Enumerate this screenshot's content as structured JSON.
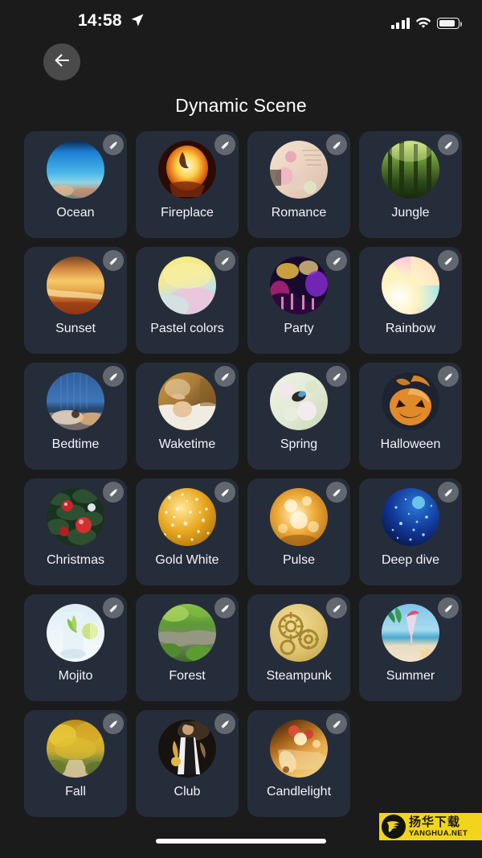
{
  "status_bar": {
    "time": "14:58",
    "location_icon": "location-arrow-icon",
    "signal_icon": "cellular-signal-icon",
    "wifi_icon": "wifi-icon",
    "battery_icon": "battery-icon",
    "battery_level": "76%"
  },
  "header": {
    "back_icon": "arrow-left-icon",
    "back_label": "Back",
    "title": "Dynamic Scene"
  },
  "colors": {
    "page_background": "#1b1b1c",
    "card_background": "#262d3a",
    "label_text": "#f2f4f7",
    "badge_background": "#7a7e85",
    "watermark_yellow": "#f2d51a",
    "home_indicator": "#ffffff"
  },
  "grid": {
    "columns": 4,
    "edit_icon": "pencil-edit-icon",
    "scenes": [
      {
        "label": "Ocean",
        "thumb": "underwater-coral-reef-photo",
        "style": "ocean"
      },
      {
        "label": "Fireplace",
        "thumb": "burning-fireplace-photo",
        "style": "fireplace"
      },
      {
        "label": "Romance",
        "thumb": "pink-roses-letter-photo",
        "style": "romance"
      },
      {
        "label": "Jungle",
        "thumb": "sunlit-jungle-trees-photo",
        "style": "jungle"
      },
      {
        "label": "Sunset",
        "thumb": "orange-beach-sunset-photo",
        "style": "sunset"
      },
      {
        "label": "Pastel colors",
        "thumb": "pastel-gradient-swatch",
        "style": "pastel"
      },
      {
        "label": "Party",
        "thumb": "concert-crowd-lights-photo",
        "style": "party"
      },
      {
        "label": "Rainbow",
        "thumb": "rainbow-conic-gradient-swatch",
        "style": "rainbow"
      },
      {
        "label": "Bedtime",
        "thumb": "sleeping-in-dim-bedroom-photo",
        "style": "bedtime"
      },
      {
        "label": "Waketime",
        "thumb": "waking-up-in-bed-photo",
        "style": "waketime"
      },
      {
        "label": "Spring",
        "thumb": "blossom-with-bee-photo",
        "style": "spring"
      },
      {
        "label": "Halloween",
        "thumb": "carved-pumpkin-photo",
        "style": "halloween"
      },
      {
        "label": "Christmas",
        "thumb": "red-baubles-on-tree-photo",
        "style": "christmas"
      },
      {
        "label": "Gold White",
        "thumb": "gold-glitter-texture",
        "style": "gold"
      },
      {
        "label": "Pulse",
        "thumb": "warm-amber-bokeh-photo",
        "style": "pulse"
      },
      {
        "label": "Deep dive",
        "thumb": "deep-blue-starry-sphere",
        "style": "deepdive"
      },
      {
        "label": "Mojito",
        "thumb": "mojito-cocktail-glass-photo",
        "style": "mojito"
      },
      {
        "label": "Forest",
        "thumb": "mossy-forest-stream-photo",
        "style": "forest"
      },
      {
        "label": "Steampunk",
        "thumb": "brass-gears-photo",
        "style": "steampunk"
      },
      {
        "label": "Summer",
        "thumb": "beach-cocktail-starfish-photo",
        "style": "summer"
      },
      {
        "label": "Fall",
        "thumb": "autumn-tree-lined-path-photo",
        "style": "fall"
      },
      {
        "label": "Club",
        "thumb": "saxophone-player-photo",
        "style": "club"
      },
      {
        "label": "Candlelight",
        "thumb": "candles-warm-glow-photo",
        "style": "candlelight"
      }
    ]
  },
  "watermark": {
    "logo_icon": "yanghua-phoenix-logo",
    "text_cn": "扬华下载",
    "text_en": "YANGHUA.NET"
  },
  "home_indicator": {
    "label": "home-indicator"
  }
}
